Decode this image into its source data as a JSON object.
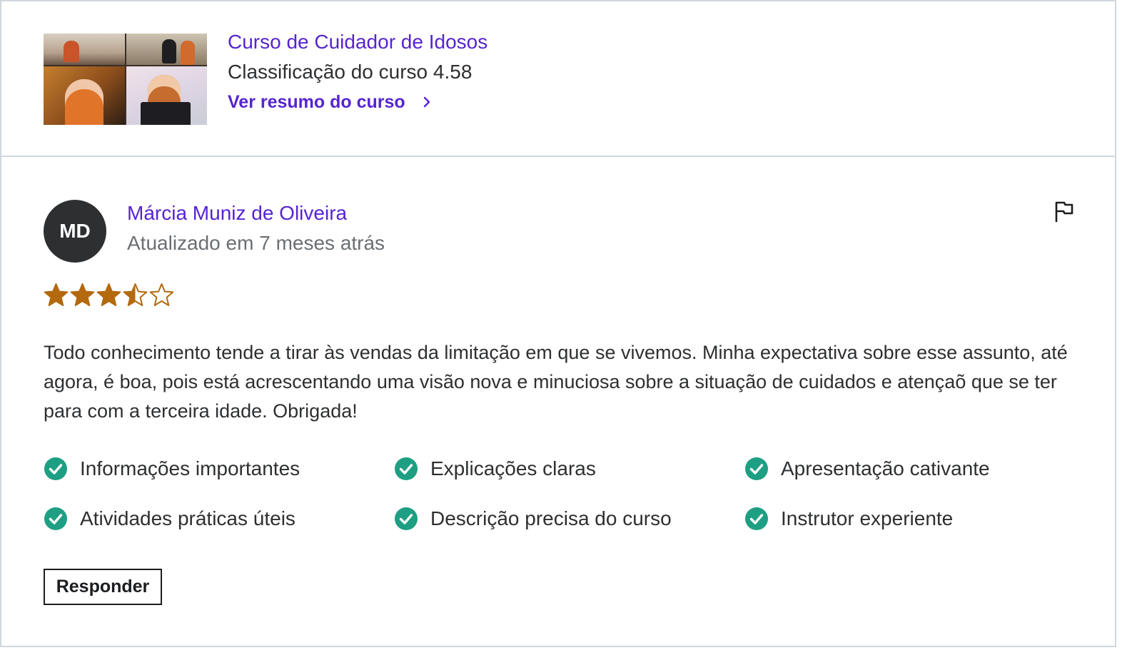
{
  "course": {
    "thumbnail_icon": "course-thumbnail-image",
    "title": "Curso de Cuidador de Idosos",
    "rating_text": "Classificação do curso 4.58",
    "summary_link": "Ver resumo do curso",
    "link_icon": "chevron-right-icon"
  },
  "review": {
    "avatar_initials": "MD",
    "reviewer_name": "Márcia Muniz de Oliveira",
    "updated_text": "Atualizado em 7 meses atrás",
    "flag_icon": "flag-icon",
    "rating": 3.5,
    "rating_max": 5,
    "text": "Todo conhecimento tende a tirar às vendas da limitação em que se vivemos. Minha expectativa sobre esse assunto, até agora, é boa, pois está acrescentando uma visão nova e minuciosa sobre a situação de cuidados e atençaõ que se ter para com a terceira idade. Obrigada!",
    "tags": [
      "Informações importantes",
      "Explicações claras",
      "Apresentação cativante",
      "Atividades práticas úteis",
      "Descrição precisa do curso",
      "Instrutor experiente"
    ],
    "reply_label": "Responder"
  },
  "colors": {
    "link": "#5624d0",
    "star": "#b4690e",
    "check": "#1e9f83",
    "avatar_bg": "#2d2f31",
    "muted_text": "#6a6f73",
    "border": "#d1d7dc"
  }
}
